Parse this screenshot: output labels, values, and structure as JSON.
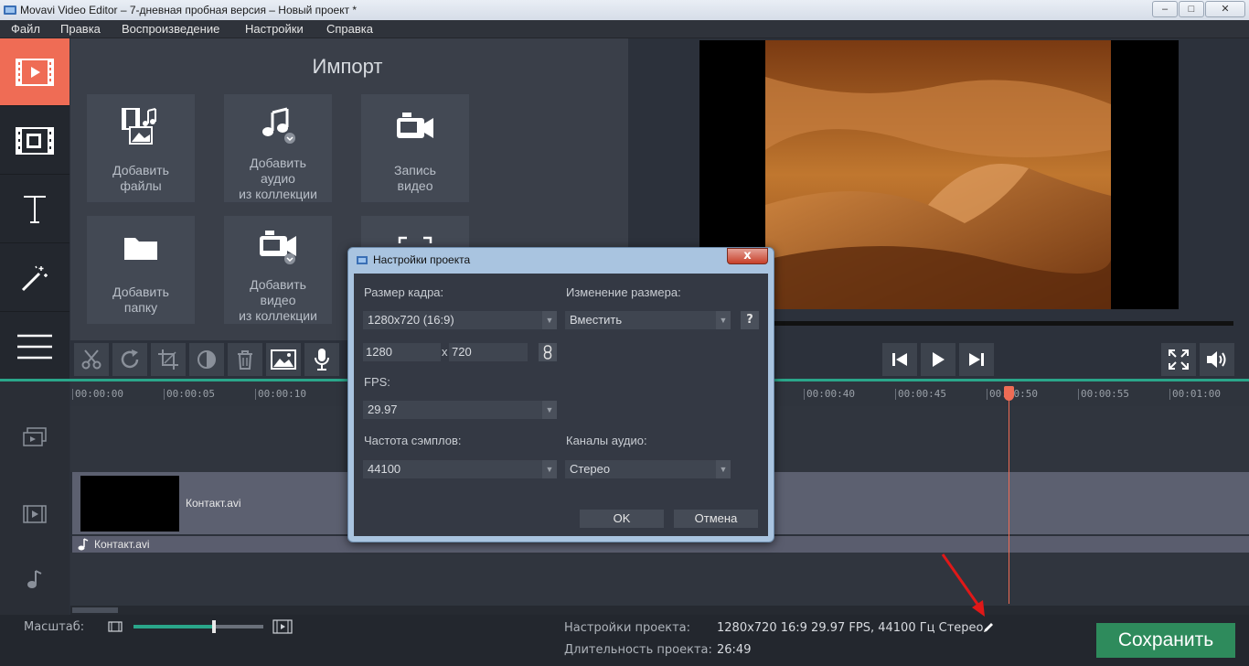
{
  "window": {
    "title": "Movavi Video Editor – 7-дневная пробная версия – Новый проект *",
    "minimize": "–",
    "maximize": "□",
    "close": "✕"
  },
  "menu": [
    "Файл",
    "Правка",
    "Воспроизведение",
    "Настройки",
    "Справка"
  ],
  "import": {
    "title": "Импорт",
    "tiles": [
      {
        "label1": "Добавить",
        "label2": "файлы",
        "label3": ""
      },
      {
        "label1": "Добавить",
        "label2": "аудио",
        "label3": "из коллекции"
      },
      {
        "label1": "Запись",
        "label2": "видео",
        "label3": ""
      },
      {
        "label1": "Добавить",
        "label2": "папку",
        "label3": ""
      },
      {
        "label1": "Добавить",
        "label2": "видео",
        "label3": "из коллекции"
      }
    ]
  },
  "timeline": {
    "ticks": [
      "00:00:00",
      "00:00:05",
      "00:00:10",
      "00:00:40",
      "00:00:45",
      "00:00:50",
      "00:00:55",
      "00:01:00"
    ],
    "video_clip": "Контакт.avi",
    "audio_clip": "Контакт.avi"
  },
  "bottom": {
    "zoom_label": "Масштаб:",
    "zoom_level": 0.62,
    "settings_label": "Настройки проекта:",
    "settings_value": "1280x720 16:9 29.97 FPS, 44100 Гц Стерео",
    "duration_label": "Длительность проекта:",
    "duration_value": "26:49",
    "save_label": "Сохранить"
  },
  "dialog": {
    "title": "Настройки проекта",
    "close": "x",
    "frame_size_label": "Размер кадра:",
    "frame_size_value": "1280x720 (16:9)",
    "resize_label": "Изменение размера:",
    "resize_value": "Вместить",
    "help": "?",
    "width_value": "1280",
    "x_sep": "x",
    "height_value": "720",
    "fps_label": "FPS:",
    "fps_value": "29.97",
    "sample_rate_label": "Частота сэмплов:",
    "sample_rate_value": "44100",
    "channels_label": "Каналы аудио:",
    "channels_value": "Стерео",
    "ok_label": "OK",
    "cancel_label": "Отмена"
  },
  "colors": {
    "accent": "#ef6c55",
    "timeline_accent": "#2aa68a",
    "save_button": "#2e8b5c"
  }
}
